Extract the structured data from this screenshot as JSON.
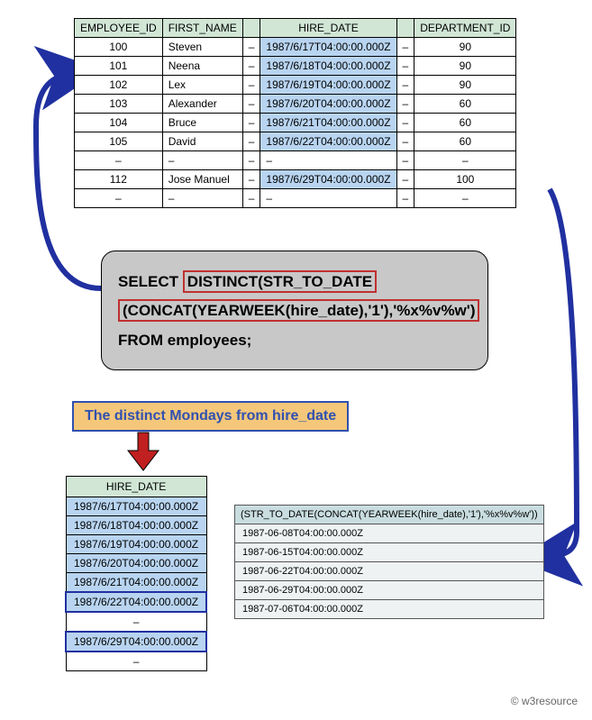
{
  "main_table": {
    "headers": [
      "EMPLOYEE_ID",
      "FIRST_NAME",
      "",
      "HIRE_DATE",
      "",
      "DEPARTMENT_ID"
    ],
    "rows": [
      {
        "id": "100",
        "name": "Steven",
        "d1": "–",
        "hire": "1987/6/17T04:00:00.000Z",
        "d2": "–",
        "dept": "90"
      },
      {
        "id": "101",
        "name": "Neena",
        "d1": "–",
        "hire": "1987/6/18T04:00:00.000Z",
        "d2": "–",
        "dept": "90"
      },
      {
        "id": "102",
        "name": "Lex",
        "d1": "–",
        "hire": "1987/6/19T04:00:00.000Z",
        "d2": "–",
        "dept": "90"
      },
      {
        "id": "103",
        "name": "Alexander",
        "d1": "–",
        "hire": "1987/6/20T04:00:00.000Z",
        "d2": "–",
        "dept": "60"
      },
      {
        "id": "104",
        "name": "Bruce",
        "d1": "–",
        "hire": "1987/6/21T04:00:00.000Z",
        "d2": "–",
        "dept": "60"
      },
      {
        "id": "105",
        "name": "David",
        "d1": "–",
        "hire": "1987/6/22T04:00:00.000Z",
        "d2": "–",
        "dept": "60"
      },
      {
        "id": "–",
        "name": "–",
        "d1": "–",
        "hire": "–",
        "d2": "–",
        "dept": "–",
        "blank": true
      },
      {
        "id": "112",
        "name": "Jose Manuel",
        "d1": "–",
        "hire": "1987/6/29T04:00:00.000Z",
        "d2": "–",
        "dept": "100"
      },
      {
        "id": "–",
        "name": "–",
        "d1": "–",
        "hire": "–",
        "d2": "–",
        "dept": "–",
        "blank": true
      }
    ]
  },
  "sql": {
    "p1": "SELECT ",
    "p2": "DISTINCT(STR_TO_DATE",
    "p3": "(CONCAT(YEARWEEK(hire_date),'1'),'%x%v%w')",
    "p4": "FROM employees;"
  },
  "caption": "The distinct Mondays from hire_date",
  "hire_table": {
    "header": "HIRE_DATE",
    "rows": [
      {
        "v": "1987/6/17T04:00:00.000Z"
      },
      {
        "v": "1987/6/18T04:00:00.000Z"
      },
      {
        "v": "1987/6/19T04:00:00.000Z"
      },
      {
        "v": "1987/6/20T04:00:00.000Z"
      },
      {
        "v": "1987/6/21T04:00:00.000Z"
      },
      {
        "v": "1987/6/22T04:00:00.000Z",
        "outlined": true
      },
      {
        "v": "–",
        "dash": true
      },
      {
        "v": "1987/6/29T04:00:00.000Z",
        "outlined": true
      },
      {
        "v": "–",
        "dash": true
      }
    ]
  },
  "result_table": {
    "header": "(STR_TO_DATE(CONCAT(YEARWEEK(hire_date),'1'),'%x%v%w'))",
    "rows": [
      "1987-06-08T04:00:00.000Z",
      "1987-06-15T04:00:00.000Z",
      "1987-06-22T04:00:00.000Z",
      "1987-06-29T04:00:00.000Z",
      "1987-07-06T04:00:00.000Z"
    ]
  },
  "credit": "© w3resource"
}
